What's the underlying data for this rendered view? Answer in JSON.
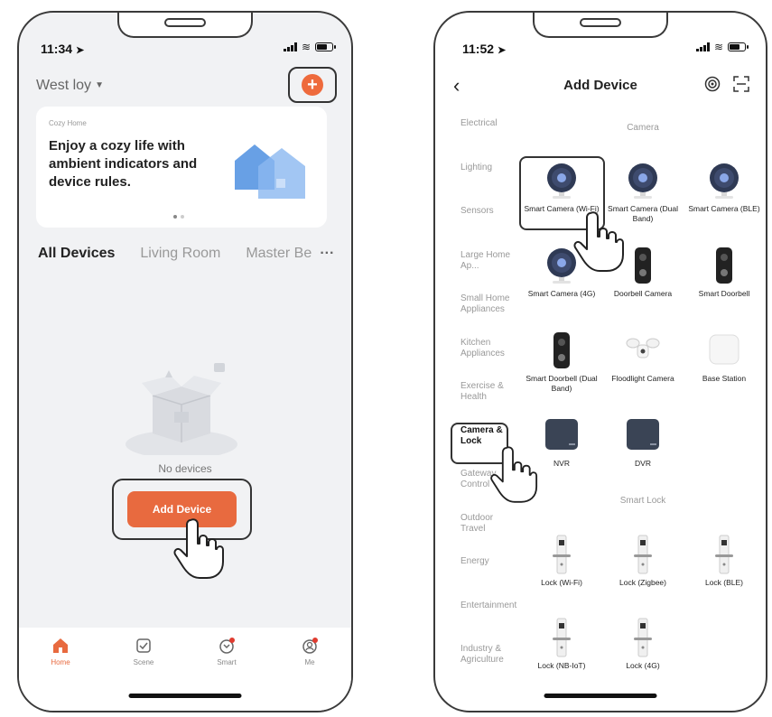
{
  "phone_home": {
    "time": "11:34",
    "home_name": "West loy",
    "banner": {
      "small_label": "Cozy Home",
      "headline": "Enjoy a cozy life with ambient indicators and device rules."
    },
    "tabs": [
      "All Devices",
      "Living Room",
      "Master Be"
    ],
    "empty_text": "No devices",
    "add_device_label": "Add Device",
    "tabbar": [
      "Home",
      "Scene",
      "Smart",
      "Me"
    ],
    "accent_color": "#e86a3f"
  },
  "phone_add": {
    "time": "11:52",
    "title": "Add Device",
    "categories": [
      "Electrical",
      "Lighting",
      "Sensors",
      "Large Home Ap...",
      "Small Home Appliances",
      "Kitchen Appliances",
      "Exercise & Health",
      "Camera & Lock",
      "Gateway Control",
      "Outdoor Travel",
      "Energy",
      "Entertainment",
      "Industry & Agriculture"
    ],
    "sections": {
      "camera": "Camera",
      "smart_lock": "Smart Lock"
    },
    "devices": [
      {
        "label": "Smart Camera (Wi-Fi)",
        "icon": "camera-icon"
      },
      {
        "label": "Smart Camera (Dual Band)",
        "icon": "camera-icon"
      },
      {
        "label": "Smart Camera (BLE)",
        "icon": "camera-icon"
      },
      {
        "label": "Smart Camera (4G)",
        "icon": "camera-icon"
      },
      {
        "label": "Doorbell Camera",
        "icon": "doorbell-icon"
      },
      {
        "label": "Smart Doorbell",
        "icon": "doorbell-icon"
      },
      {
        "label": "Smart Doorbell (Dual Band)",
        "icon": "doorbell-icon"
      },
      {
        "label": "Floodlight Camera",
        "icon": "floodlight-icon"
      },
      {
        "label": "Base Station",
        "icon": "base-station-icon"
      },
      {
        "label": "NVR",
        "icon": "nvr-icon"
      },
      {
        "label": "DVR",
        "icon": "dvr-icon"
      }
    ],
    "locks": [
      {
        "label": "Lock (Wi-Fi)",
        "icon": "lock-icon"
      },
      {
        "label": "Lock (Zigbee)",
        "icon": "lock-icon"
      },
      {
        "label": "Lock (BLE)",
        "icon": "lock-icon"
      },
      {
        "label": "Lock (NB-IoT)",
        "icon": "lock-icon"
      },
      {
        "label": "Lock (4G)",
        "icon": "lock-icon"
      }
    ]
  }
}
